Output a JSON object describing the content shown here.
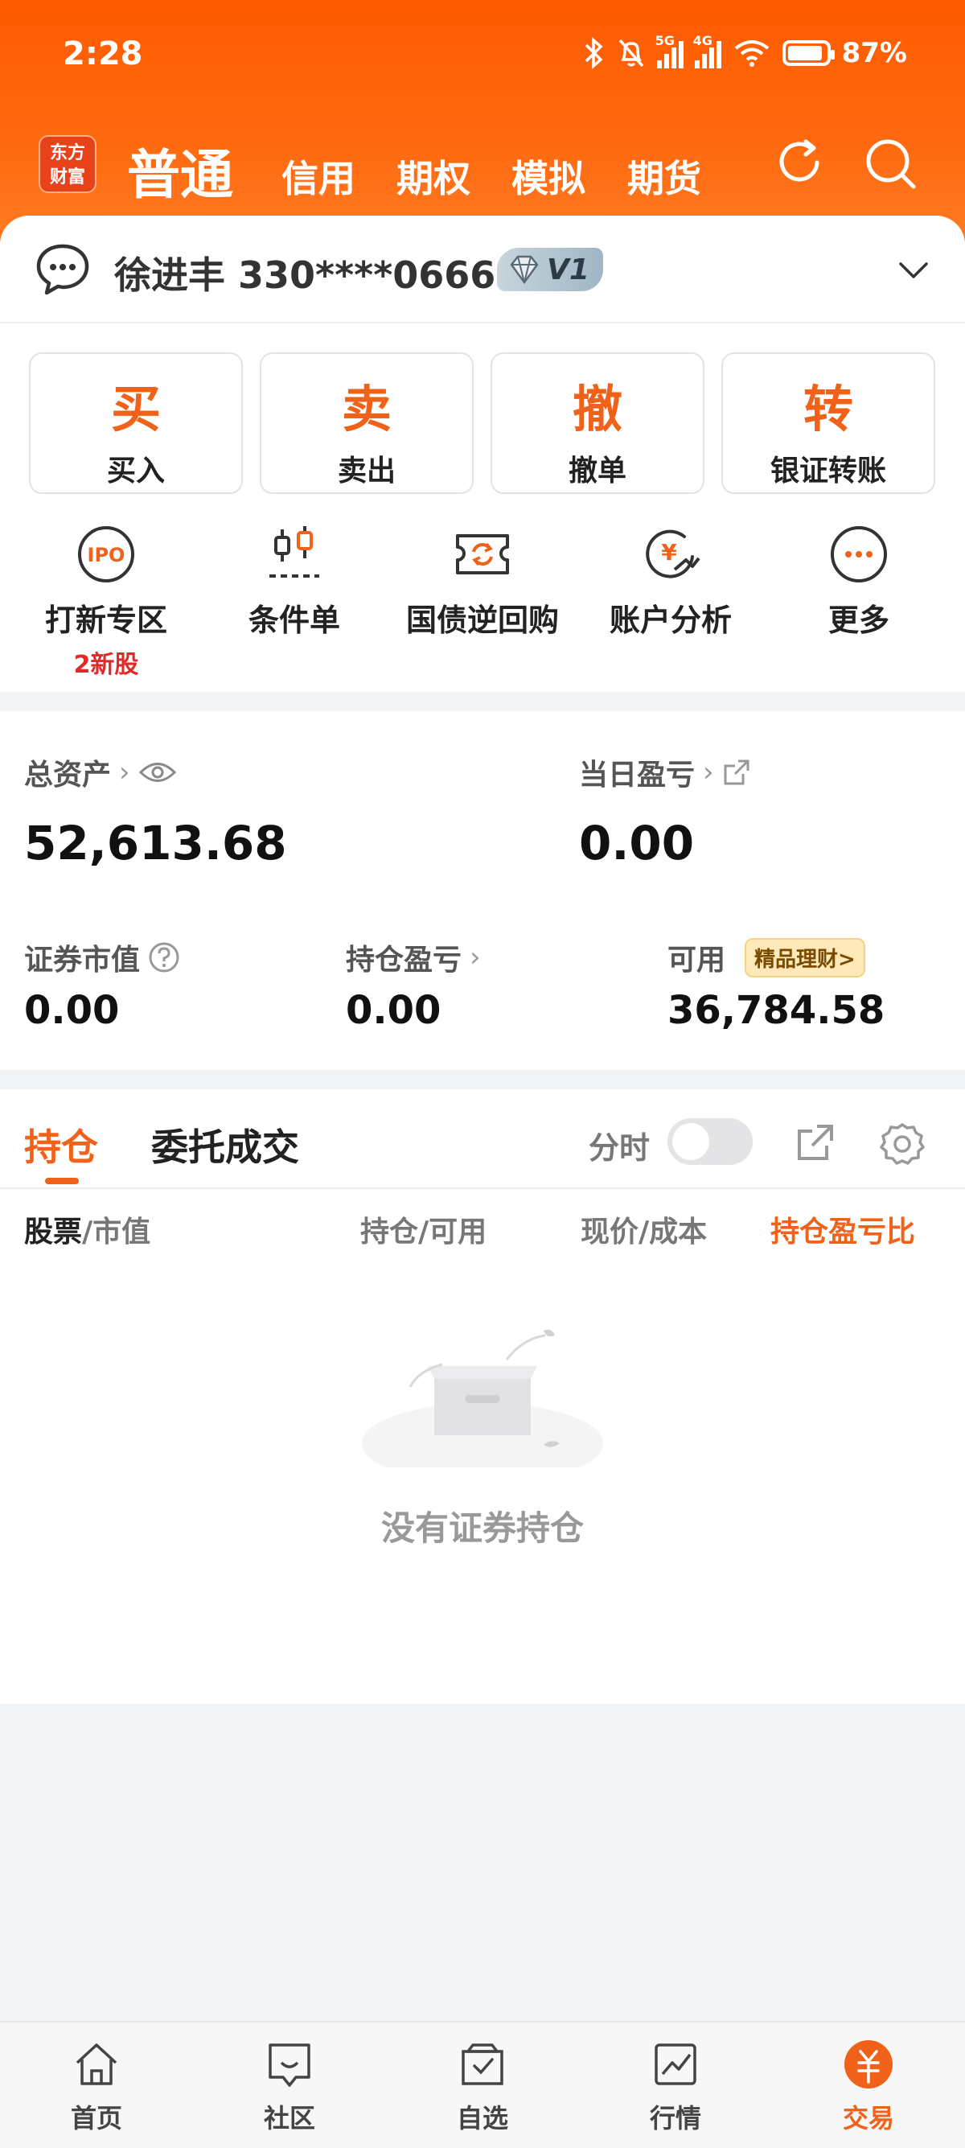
{
  "status_bar": {
    "time": "2:28",
    "battery": "87%",
    "net1": "5G",
    "net2": "4G"
  },
  "header": {
    "logo_line1": "东方",
    "logo_line2": "财富",
    "tabs": [
      "普通",
      "信用",
      "期权",
      "模拟",
      "期货"
    ]
  },
  "account": {
    "name": "徐进丰 330****0666",
    "level": "V1"
  },
  "quick_actions": [
    {
      "big": "买",
      "small": "买入"
    },
    {
      "big": "卖",
      "small": "卖出"
    },
    {
      "big": "撤",
      "small": "撤单"
    },
    {
      "big": "转",
      "small": "银证转账"
    }
  ],
  "functions": [
    {
      "label": "打新专区",
      "sub": "2新股",
      "icon": "ipo-icon"
    },
    {
      "label": "条件单",
      "icon": "candlestick-icon"
    },
    {
      "label": "国债逆回购",
      "icon": "ticket-icon"
    },
    {
      "label": "账户分析",
      "icon": "yen-chart-icon"
    },
    {
      "label": "更多",
      "icon": "more-icon"
    }
  ],
  "assets": {
    "total_label": "总资产",
    "total_value": "52,613.68",
    "daily_label": "当日盈亏",
    "daily_value": "0.00",
    "market_label": "证券市值",
    "market_value": "0.00",
    "position_pl_label": "持仓盈亏",
    "position_pl_value": "0.00",
    "available_label": "可用",
    "available_value": "36,784.58",
    "finance_badge": "精品理财>"
  },
  "holdings": {
    "tab_active": "持仓",
    "tab_other": "委托成交",
    "fenshi_label": "分时",
    "col1_main": "股票",
    "col1_sub": "/市值",
    "col2": "持仓/可用",
    "col3": "现价/成本",
    "col4": "持仓盈亏比",
    "empty_text": "没有证券持仓"
  },
  "bottom_nav": [
    {
      "label": "首页",
      "icon": "home-icon"
    },
    {
      "label": "社区",
      "icon": "community-icon"
    },
    {
      "label": "自选",
      "icon": "watchlist-icon"
    },
    {
      "label": "行情",
      "icon": "market-icon"
    },
    {
      "label": "交易",
      "icon": "trade-icon",
      "active": true
    }
  ],
  "colors": {
    "brand": "#ff5a00",
    "accent": "#f0621a",
    "alert": "#e02a2a"
  }
}
